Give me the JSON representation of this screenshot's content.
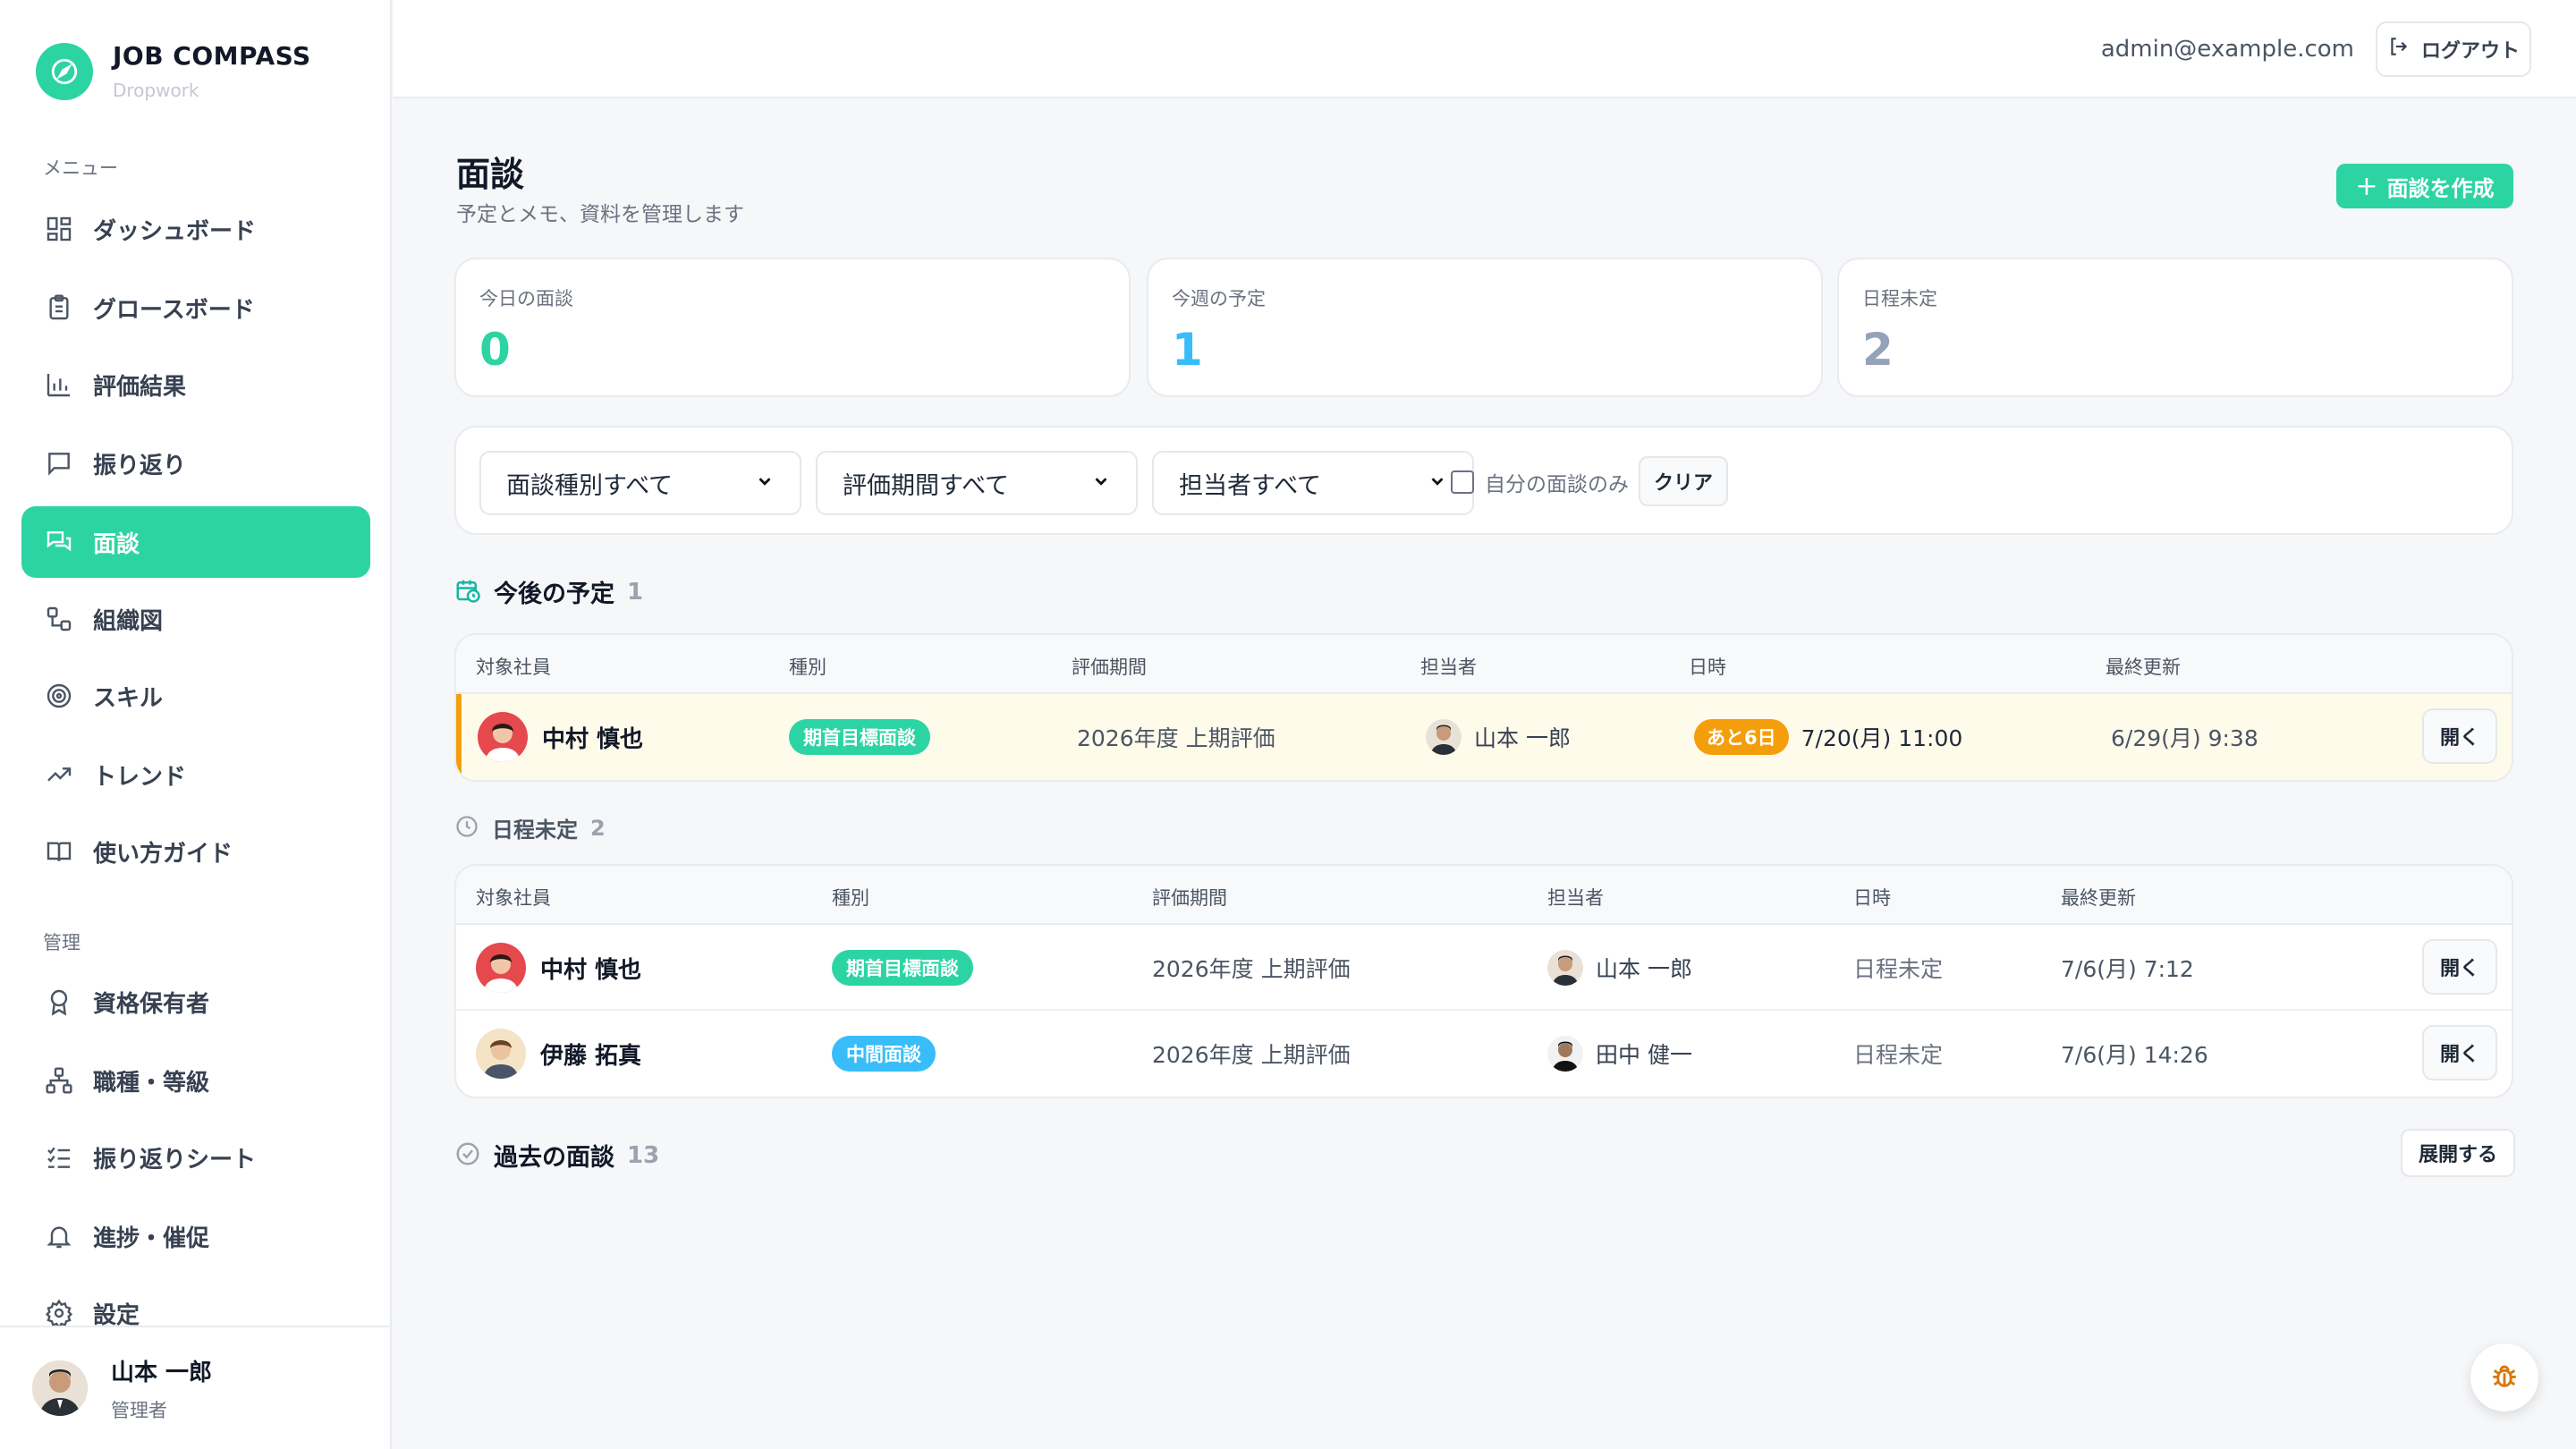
{
  "brand": {
    "name": "JOB COMPASS",
    "sub": "Dropwork"
  },
  "menu_label": "メニュー",
  "menu_items": [
    {
      "label": "ダッシュボード",
      "icon": "dashboard-icon"
    },
    {
      "label": "グロースボード",
      "icon": "clipboard-icon"
    },
    {
      "label": "評価結果",
      "icon": "bar-chart-icon"
    },
    {
      "label": "振り返り",
      "icon": "chat-icon"
    },
    {
      "label": "面談",
      "icon": "chats-icon",
      "active": true
    },
    {
      "label": "組織図",
      "icon": "org-icon"
    },
    {
      "label": "スキル",
      "icon": "target-icon"
    },
    {
      "label": "トレンド",
      "icon": "trend-icon"
    },
    {
      "label": "使い方ガイド",
      "icon": "book-icon"
    }
  ],
  "admin_label": "管理",
  "admin_items": [
    {
      "label": "資格保有者",
      "icon": "award-icon"
    },
    {
      "label": "職種・等級",
      "icon": "hierarchy-icon"
    },
    {
      "label": "振り返りシート",
      "icon": "checklist-icon"
    },
    {
      "label": "進捗・催促",
      "icon": "bell-icon"
    },
    {
      "label": "設定",
      "icon": "gear-icon"
    }
  ],
  "current_user": {
    "name": "山本 一郎",
    "role": "管理者"
  },
  "topbar": {
    "email": "admin@example.com",
    "logout": "ログアウト"
  },
  "page": {
    "title": "面談",
    "subtitle": "予定とメモ、資料を管理します",
    "create_button": "面談を作成"
  },
  "stats": [
    {
      "label": "今日の面談",
      "value": "0",
      "color": "#2dd4a3"
    },
    {
      "label": "今週の予定",
      "value": "1",
      "color": "#38bdf8"
    },
    {
      "label": "日程未定",
      "value": "2",
      "color": "#94a3b8"
    }
  ],
  "filters": {
    "type": "面談種別すべて",
    "period": "評価期間すべて",
    "owner": "担当者すべて",
    "mine_only": "自分の面談のみ",
    "clear": "クリア"
  },
  "upcoming": {
    "title": "今後の予定",
    "count": "1",
    "headers": [
      "対象社員",
      "種別",
      "評価期間",
      "担当者",
      "日時",
      "最終更新"
    ],
    "rows": [
      {
        "employee": "中村 慎也",
        "type": "期首目標面談",
        "period": "2026年度 上期評価",
        "owner": "山本 一郎",
        "countdown": "あと6日",
        "datetime": "7/20(月) 11:00",
        "updated": "6/29(月) 9:38",
        "open": "開く"
      }
    ]
  },
  "unscheduled": {
    "title": "日程未定",
    "count": "2",
    "headers": [
      "対象社員",
      "種別",
      "評価期間",
      "担当者",
      "日時",
      "最終更新"
    ],
    "rows": [
      {
        "employee": "中村 慎也",
        "type": "期首目標面談",
        "period": "2026年度 上期評価",
        "owner": "山本 一郎",
        "datetime": "日程未定",
        "updated": "7/6(月) 7:12",
        "open": "開く"
      },
      {
        "employee": "伊藤 拓真",
        "type": "中間面談",
        "period": "2026年度 上期評価",
        "owner": "田中 健一",
        "datetime": "日程未定",
        "updated": "7/6(月) 14:26",
        "open": "開く"
      }
    ]
  },
  "past": {
    "title": "過去の面談",
    "count": "13",
    "expand": "展開する"
  },
  "colors": {
    "accent": "#2dd4a3",
    "warning": "#f59e0b",
    "info": "#38bdf8"
  }
}
